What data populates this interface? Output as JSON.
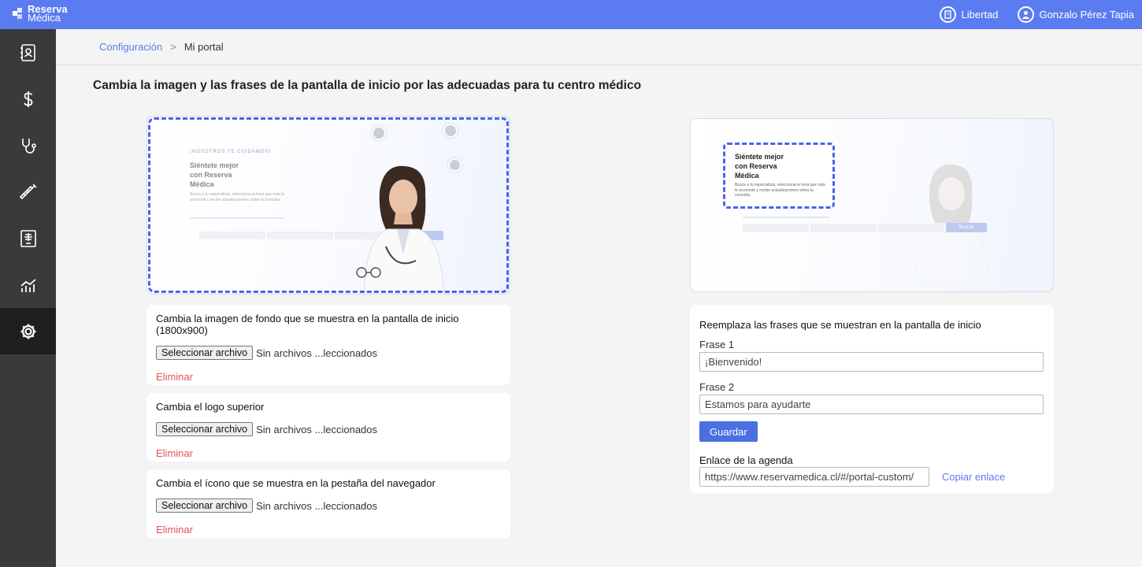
{
  "header": {
    "logo_line1": "Reserva",
    "logo_line2": "Médica",
    "center_name": "Libertad",
    "user_name": "Gonzalo Pérez Tapia"
  },
  "sidebar": {
    "items": [
      {
        "icon": "contacts-book-icon"
      },
      {
        "icon": "dollar-icon"
      },
      {
        "icon": "stethoscope-icon"
      },
      {
        "icon": "syringe-icon"
      },
      {
        "icon": "xray-icon"
      },
      {
        "icon": "chart-icon"
      },
      {
        "icon": "gear-icon",
        "active": true
      }
    ]
  },
  "breadcrumb": {
    "parent": "Configuración",
    "separator": ">",
    "current": "Mi portal"
  },
  "page_title": "Cambia la imagen y las frases de la pantalla de inicio por las adecuadas para tu centro médico",
  "left_preview": {
    "small_heading": "¡NOSOTROS TE CUIDAMOS!",
    "headline_1": "Siéntete mejor",
    "headline_2": "con Reserva",
    "headline_3": "Médica",
    "subtext": "Busca a tu especialista, selecciona la hora que más te acomode y recibe actualizaciones sobre tu consulta."
  },
  "right_preview": {
    "headline_1": "Siéntete mejor",
    "headline_2": "con Reserva",
    "headline_3": "Médica",
    "subtext": "Busca a tu especialista, selecciona la hora que más te acomode y recibe actualizaciones sobre tu consulta.",
    "search_button": "Buscar"
  },
  "upload_cards": [
    {
      "title": "Cambia la imagen de fondo que se muestra en la pantalla de inicio (1800x900)",
      "button": "Seleccionar archivo",
      "status": "Sin archivos ...leccionados",
      "delete": "Eliminar"
    },
    {
      "title": "Cambia el logo superior",
      "button": "Seleccionar archivo",
      "status": "Sin archivos ...leccionados",
      "delete": "Eliminar"
    },
    {
      "title": "Cambia el ícono que se muestra en la pestaña del navegador",
      "button": "Seleccionar archivo",
      "status": "Sin archivos ...leccionados",
      "delete": "Eliminar"
    }
  ],
  "phrases_form": {
    "title": "Reemplaza las frases que se muestran en la pantalla de inicio",
    "phrase1_label": "Frase 1",
    "phrase1_value": "¡Bienvenido!",
    "phrase2_label": "Frase 2",
    "phrase2_value": "Estamos para ayudarte",
    "save_label": "Guardar",
    "link_label": "Enlace de la agenda",
    "link_value": "https://www.reservamedica.cl/#/portal-custom/",
    "copy_label": "Copiar enlace"
  },
  "colors": {
    "topbar": "#5b7cf0",
    "sidebar": "#3a3a3a",
    "accent": "#4a6fe0",
    "danger": "#e05353"
  }
}
